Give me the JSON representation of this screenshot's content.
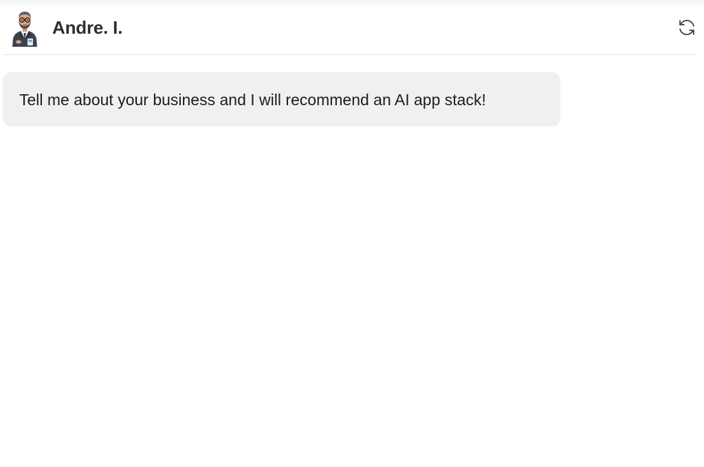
{
  "header": {
    "name": "Andre. I.",
    "avatar_icon": "businessman-avatar-icon",
    "refresh_icon": "refresh-icon"
  },
  "messages": [
    {
      "role": "assistant",
      "text": "Tell me about your business and I will recommend an AI app stack!"
    }
  ],
  "colors": {
    "bubble_bg": "#f0f0ef",
    "divider": "#e4e4e4",
    "name_text": "#2e2e33",
    "message_text": "#1d1d1f"
  }
}
